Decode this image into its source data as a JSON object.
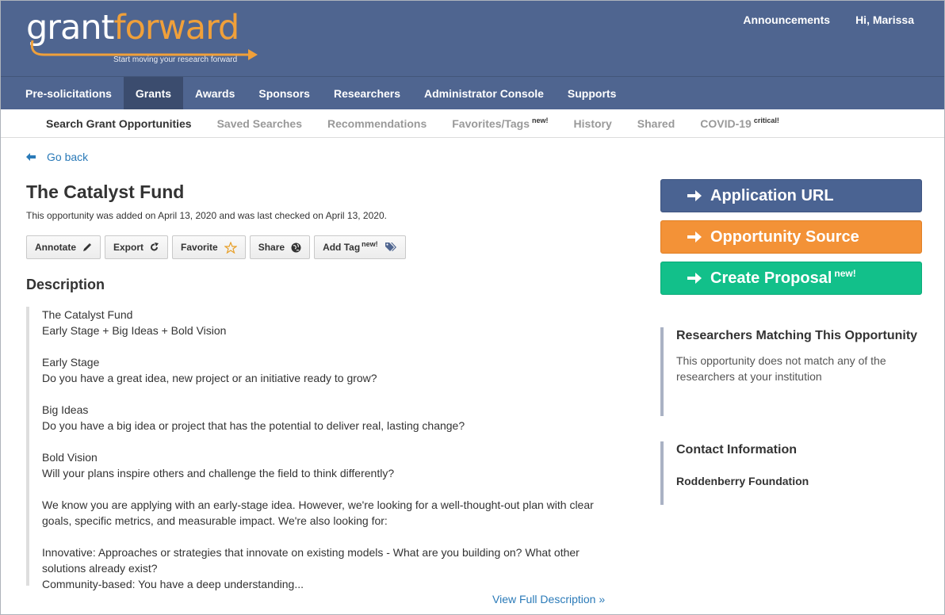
{
  "header": {
    "logo": {
      "grant": "grant",
      "forward": "forward",
      "tagline": "Start moving your research forward"
    },
    "announcements": "Announcements",
    "greeting": "Hi, Marissa"
  },
  "main_nav": [
    {
      "label": "Pre-solicitations"
    },
    {
      "label": "Grants",
      "active": true
    },
    {
      "label": "Awards"
    },
    {
      "label": "Sponsors"
    },
    {
      "label": "Researchers"
    },
    {
      "label": "Administrator Console"
    },
    {
      "label": "Supports"
    }
  ],
  "sub_nav": {
    "search": "Search Grant Opportunities",
    "saved": "Saved Searches",
    "recommendations": "Recommendations",
    "favorites": "Favorites/Tags",
    "favorites_badge": "new!",
    "history": "History",
    "shared": "Shared",
    "covid": "COVID-19",
    "covid_badge": "critical!"
  },
  "page": {
    "go_back": "Go back",
    "title": "The Catalyst Fund",
    "subtitle": "This opportunity was added on April 13, 2020 and was last checked on April 13, 2020.",
    "actions": {
      "annotate": "Annotate",
      "export": "Export",
      "favorite": "Favorite",
      "share": "Share",
      "add_tag": "Add Tag",
      "add_tag_badge": "new!"
    },
    "description_heading": "Description",
    "description": {
      "p1_l1": "The Catalyst Fund",
      "p1_l2": "Early Stage + Big Ideas + Bold Vision",
      "p2_l1": "Early Stage",
      "p2_l2": "Do you have a great idea, new project or an initiative ready to grow?",
      "p3_l1": "Big Ideas",
      "p3_l2": "Do you have a big idea or project that has the potential to deliver real, lasting change?",
      "p4_l1": "Bold Vision",
      "p4_l2": "Will your plans inspire others and challenge the field to think differently?",
      "p5": "We know you are applying with an early-stage idea. However, we're looking for a well-thought-out plan with clear goals, specific metrics, and measurable impact. We're also looking for:",
      "p6_l1": "Innovative: Approaches or strategies that innovate on existing models - What are you building on? What other solutions already exist?",
      "p6_l2": "Community-based: You have a deep understanding..."
    },
    "view_full": "View Full Description »"
  },
  "sidebar": {
    "application_url": "Application URL",
    "opportunity_source": "Opportunity Source",
    "create_proposal": "Create Proposal",
    "create_proposal_badge": "new!",
    "researchers_title": "Researchers Matching This Opportunity",
    "researchers_text": "This opportunity does not match any of the researchers at your institution",
    "contact_title": "Contact Information",
    "contact_org": "Roddenberry Foundation"
  },
  "colors": {
    "header_bg": "#4f6590",
    "active_nav_bg": "#3b4c6e",
    "logo_orange": "#f0a03a",
    "link_blue": "#2a7ab8",
    "btn_blue": "#4a6392",
    "btn_orange": "#f39237",
    "btn_green": "#12c08a"
  },
  "icons": [
    "arrow-left-icon",
    "pencil-icon",
    "export-icon",
    "star-icon",
    "globe-icon",
    "tag-icon",
    "arrow-right-icon"
  ]
}
